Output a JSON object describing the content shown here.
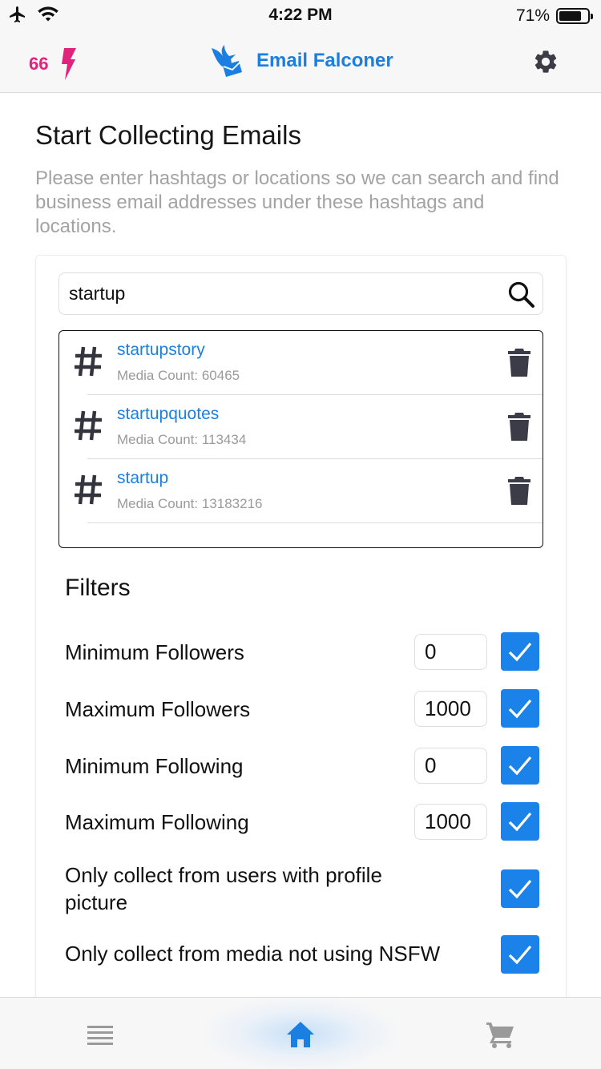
{
  "status_bar": {
    "time": "4:22 PM",
    "battery_percent": "71%",
    "battery_level": 0.71
  },
  "header": {
    "credits": "66",
    "app_title": "Email Falconer",
    "icons": [
      "lightning-icon",
      "falcon-logo",
      "gear-icon"
    ],
    "credits_color": "#e0247d",
    "accent_color": "#1a7fe0"
  },
  "main": {
    "title": "Start Collecting Emails",
    "description": "Please enter hashtags or locations so we can search and find business email addresses under these hashtags and locations."
  },
  "search": {
    "value": "startup",
    "placeholder": ""
  },
  "hashtags": [
    {
      "name": "startupstory",
      "count": "Media Count: 60465"
    },
    {
      "name": "startupquotes",
      "count": "Media Count: 113434"
    },
    {
      "name": "startup",
      "count": "Media Count: 13183216"
    }
  ],
  "filters": {
    "title": "Filters",
    "items": [
      {
        "label": "Minimum Followers",
        "value": "0",
        "checked": true
      },
      {
        "label": "Maximum Followers",
        "value": "1000",
        "checked": true
      },
      {
        "label": "Minimum Following",
        "value": "0",
        "checked": true
      },
      {
        "label": "Maximum Following",
        "value": "1000",
        "checked": true
      },
      {
        "label": "Only collect from users with profile picture",
        "checked": true
      },
      {
        "label": "Only collect from media not using NSFW",
        "checked": true
      }
    ],
    "checkbox_color": "#1b82ea"
  },
  "tab_bar": {
    "tabs": [
      {
        "icon": "menu-icon",
        "active": false
      },
      {
        "icon": "home-icon",
        "active": true
      },
      {
        "icon": "cart-icon",
        "active": false
      }
    ],
    "active_color": "#1a7fe0",
    "inactive_color": "#9a9a9a"
  }
}
